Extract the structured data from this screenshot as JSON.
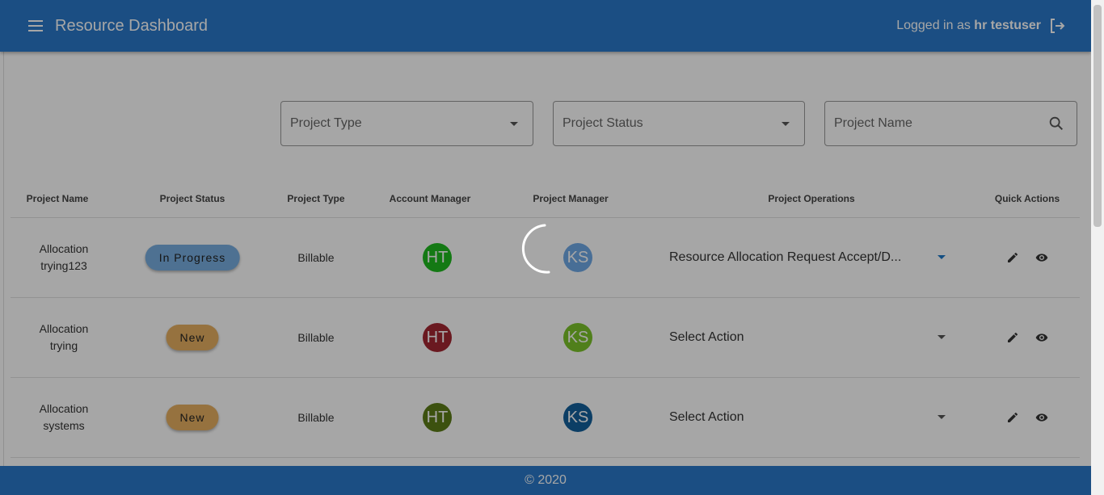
{
  "appbar": {
    "title": "Resource Dashboard",
    "login_prefix": "Logged in as",
    "username": "hr testuser"
  },
  "filters": {
    "project_type": "Project Type",
    "project_status": "Project Status",
    "project_name": "Project Name"
  },
  "table": {
    "headers": [
      "Project Name",
      "Project Status",
      "Project Type",
      "Account Manager",
      "Project Manager",
      "Project Operations",
      "Quick Actions"
    ],
    "rows": [
      {
        "name_line1": "Allocation",
        "name_line2": "trying123",
        "status": "In Progress",
        "status_color": "#78aee0",
        "type": "Billable",
        "account_manager": "HT",
        "account_manager_color": "#1fba1f",
        "project_manager": "KS",
        "project_manager_color": "#6fa9e6",
        "operation": "Resource Allocation Request Accept/D..."
      },
      {
        "name_line1": "Allocation",
        "name_line2": "trying",
        "status": "New",
        "status_color": "#e6b062",
        "type": "Billable",
        "account_manager": "HT",
        "account_manager_color": "#a32732",
        "project_manager": "KS",
        "project_manager_color": "#7bc42a",
        "operation": "Select Action"
      },
      {
        "name_line1": "Allocation",
        "name_line2": "systems",
        "status": "New",
        "status_color": "#e6b062",
        "type": "Billable",
        "account_manager": "HT",
        "account_manager_color": "#5c7d18",
        "project_manager": "KS",
        "project_manager_color": "#13609c",
        "operation": "Select Action"
      }
    ]
  },
  "footer": {
    "copyright": "© 2020"
  },
  "colors": {
    "primary": "#2a79c9",
    "overlay": "rgba(0,0,0,0.35)"
  }
}
